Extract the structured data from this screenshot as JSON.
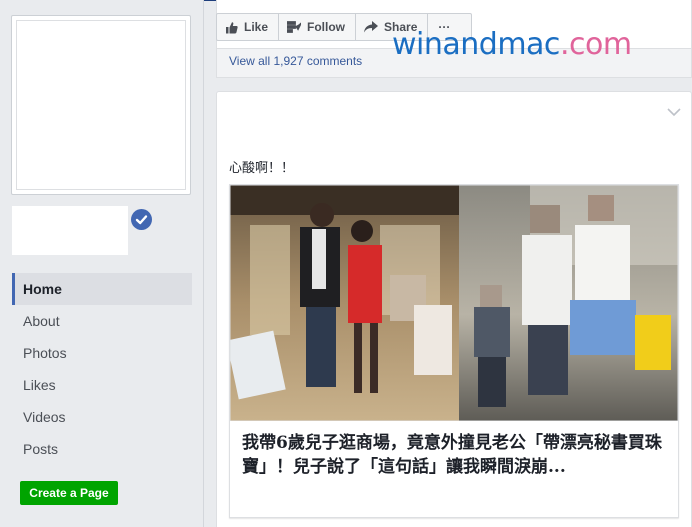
{
  "sidebar": {
    "nav_items": [
      {
        "label": "Home",
        "active": true
      },
      {
        "label": "About",
        "active": false
      },
      {
        "label": "Photos",
        "active": false
      },
      {
        "label": "Likes",
        "active": false
      },
      {
        "label": "Videos",
        "active": false
      },
      {
        "label": "Posts",
        "active": false
      }
    ],
    "create_page_label": "Create a Page",
    "verified_icon": "verified-badge-icon"
  },
  "top_post": {
    "actions": {
      "like_label": "Like",
      "follow_label": "Follow",
      "share_label": "Share",
      "more_label": "···"
    },
    "view_comments": "View all 1,927 comments"
  },
  "watermark": {
    "part1": "winandmac",
    "part2": ".com",
    "color1": "#1b6ec2",
    "color2": "#e0649b"
  },
  "post": {
    "text": "心酸啊！！",
    "link_title": "我帶6歲兒子逛商場，竟意外撞見老公「帶漂亮秘書買珠寶」！兒子說了「這句話」讓我瞬間淚崩...",
    "menu_icon": "chevron-down-icon"
  },
  "colors": {
    "accent": "#4267b2",
    "link": "#365899",
    "create_button": "#00a400",
    "background": "#e9ebee"
  }
}
